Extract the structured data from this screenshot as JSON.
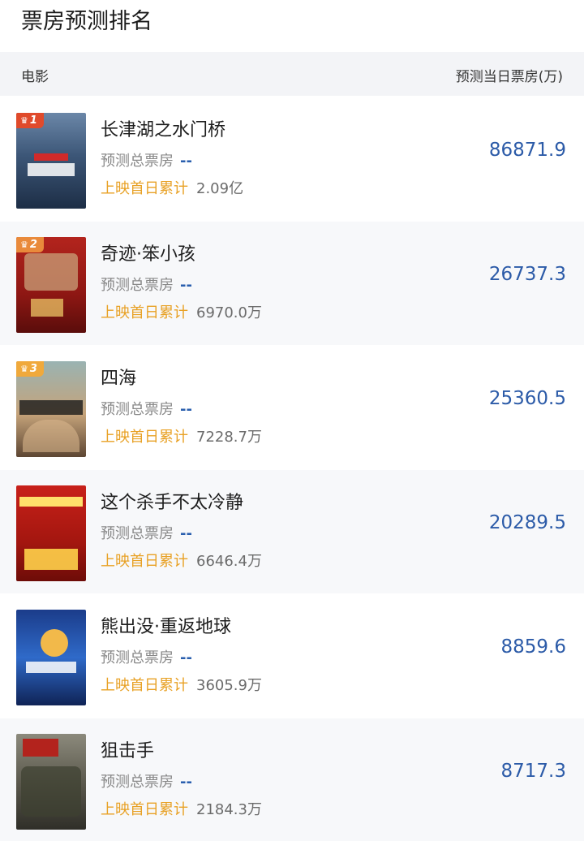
{
  "page": {
    "title": "票房预测排名"
  },
  "header": {
    "left": "电影",
    "right": "预测当日票房(万)"
  },
  "labels": {
    "forecast_total": "预测总票房",
    "dash": "--",
    "cumulative": "上映首日累计"
  },
  "colors": {
    "accent_blue": "#2c5ba8",
    "cumulative_orange": "#e8a125",
    "rank1": "#e04a2b",
    "rank2": "#e98a3b",
    "rank3": "#f0a93c"
  },
  "movies": [
    {
      "rank": "1",
      "title": "长津湖之水门桥",
      "cumulative": "2.09亿",
      "box": "86871.9"
    },
    {
      "rank": "2",
      "title": "奇迹·笨小孩",
      "cumulative": "6970.0万",
      "box": "26737.3"
    },
    {
      "rank": "3",
      "title": "四海",
      "cumulative": "7228.7万",
      "box": "25360.5"
    },
    {
      "rank": "",
      "title": "这个杀手不太冷静",
      "cumulative": "6646.4万",
      "box": "20289.5"
    },
    {
      "rank": "",
      "title": "熊出没·重返地球",
      "cumulative": "3605.9万",
      "box": "8859.6"
    },
    {
      "rank": "",
      "title": "狙击手",
      "cumulative": "2184.3万",
      "box": "8717.3"
    }
  ]
}
